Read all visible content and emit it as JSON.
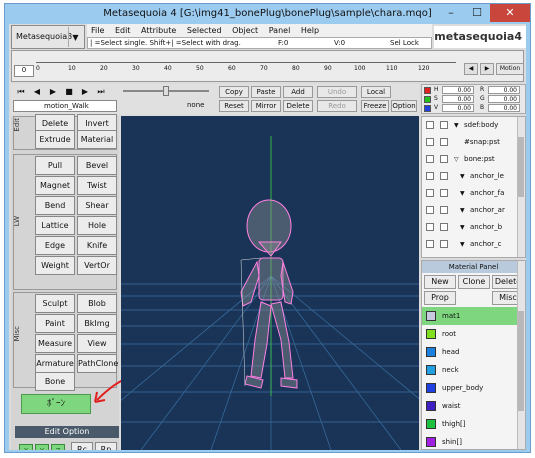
{
  "window": {
    "title": "Metasequoia 4 [G:\\img41_bonePlug\\bonePlug\\sample\\chara.mqo]",
    "minimize": "–",
    "maximize": "☐",
    "close": "✕"
  },
  "mode": {
    "label": "Metasequoia3"
  },
  "menu": [
    "File",
    "Edit",
    "Attribute",
    "Selected",
    "Object",
    "Panel",
    "Help"
  ],
  "status": {
    "hint": "| =Select single.  Shift+| =Select with drag.",
    "f": "F:0",
    "v": "V:0",
    "sel_lock": "Sel Lock"
  },
  "logo": "metasequoia4",
  "timeline": {
    "frame": "0",
    "ticks": [
      "0",
      "10",
      "20",
      "30",
      "40",
      "50",
      "60",
      "70",
      "80",
      "90",
      "100",
      "110",
      "120"
    ],
    "motion_button": "Motion"
  },
  "playback": {
    "motion_name": "motion_Walk",
    "target": "none"
  },
  "edit_buttons": {
    "copy": "Copy",
    "paste": "Paste",
    "add": "Add",
    "undo": "Undo",
    "local": "Local",
    "reset": "Reset",
    "mirror": "Mirror",
    "delete": "Delete",
    "redo": "Redo",
    "freeze": "Freeze",
    "option": "Option"
  },
  "color": {
    "h_label": "H",
    "s_label": "S",
    "v_label": "V",
    "r_label": "R",
    "g_label": "G",
    "b_label": "B",
    "h": "0.00",
    "s": "0.00",
    "v": "0.00",
    "r": "0.00",
    "g": "0.00",
    "b": "0.00"
  },
  "commands": {
    "edit_label": "Edit",
    "delete": "Delete",
    "invert": "Invert",
    "extrude": "Extrude",
    "material": "Material",
    "lw_label": "LW",
    "pull": "Pull",
    "bevel": "Bevel",
    "magnet": "Magnet",
    "twist": "Twist",
    "bend": "Bend",
    "shear": "Shear",
    "lattice": "Lattice",
    "hole": "Hole",
    "edge": "Edge",
    "knife": "Knife",
    "weight": "Weight",
    "vertor": "VertOr",
    "misc_label": "Misc",
    "sculpt": "Sculpt",
    "blob": "Blob",
    "paint": "Paint",
    "bkimg": "BkImg",
    "measure": "Measure",
    "view": "View",
    "armature": "Armature",
    "pathclone": "PathClone",
    "bone": "Bone",
    "plugin": "ﾎﾞｰﾝ"
  },
  "edit_option": {
    "title": "Edit Option",
    "x": "X",
    "y": "Y",
    "z": "Z",
    "rc": "Rc",
    "rp": "Rp"
  },
  "objects": [
    {
      "name": "sdef:body",
      "indent": 0,
      "expand": "▼"
    },
    {
      "name": "#snap:pst",
      "indent": 0,
      "expand": ""
    },
    {
      "name": "bone:pst",
      "indent": 0,
      "expand": "▽"
    },
    {
      "name": "anchor_le",
      "indent": 1,
      "expand": "▼"
    },
    {
      "name": "anchor_fa",
      "indent": 1,
      "expand": "▼"
    },
    {
      "name": "anchor_ar",
      "indent": 1,
      "expand": "▼"
    },
    {
      "name": "anchor_b",
      "indent": 1,
      "expand": "▼"
    },
    {
      "name": "anchor_c",
      "indent": 1,
      "expand": "▼"
    }
  ],
  "material_panel": {
    "title": "Material Panel",
    "new": "New",
    "clone": "Clone",
    "delete": "Delete",
    "prop": "Prop",
    "misc": "Misc",
    "items": [
      {
        "name": "mat1",
        "color": "#c8c8e0"
      },
      {
        "name": "root",
        "color": "#80e020"
      },
      {
        "name": "head",
        "color": "#2080e0"
      },
      {
        "name": "neck",
        "color": "#20a0e0"
      },
      {
        "name": "upper_body",
        "color": "#2040e0"
      },
      {
        "name": "waist",
        "color": "#4020c0"
      },
      {
        "name": "thigh[]",
        "color": "#20c040"
      },
      {
        "name": "shin[]",
        "color": "#a020e0"
      },
      {
        "name": "toe[]",
        "color": "#20a0f0"
      }
    ]
  },
  "colors": {
    "accent_green": "#7ed77e",
    "viewport_bg": "#1a3458",
    "mesh": "#ff80e0"
  }
}
